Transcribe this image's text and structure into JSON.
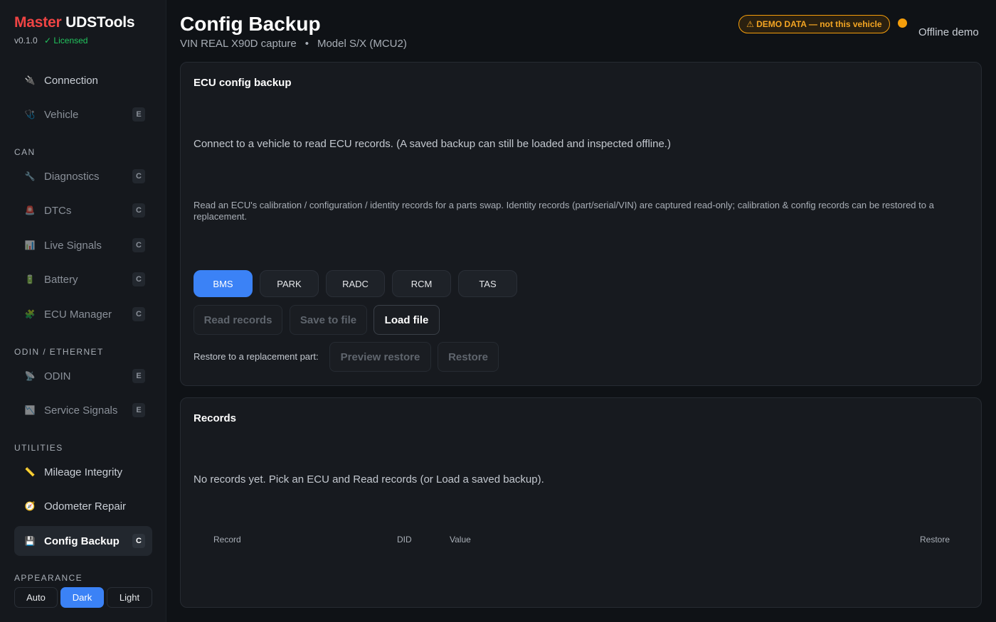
{
  "app": {
    "brand_red": "Master",
    "brand_white": "UDSTools",
    "version": "v0.1.0",
    "license": "✓ Licensed"
  },
  "sidebar": {
    "top_items": [
      {
        "label": "Connection",
        "icon": "plug-icon",
        "glyph": "🔌",
        "kbd": ""
      },
      {
        "label": "Vehicle",
        "icon": "stethoscope-icon",
        "glyph": "🩺",
        "kbd": "E"
      }
    ],
    "sections": {
      "can": "CAN",
      "odin": "ODIN / ETHERNET",
      "utilities": "UTILITIES",
      "appearance": "APPEARANCE"
    },
    "can_items": [
      {
        "label": "Diagnostics",
        "icon": "wrench-icon",
        "glyph": "🔧",
        "kbd": "C"
      },
      {
        "label": "DTCs",
        "icon": "alarm-icon",
        "glyph": "🚨",
        "kbd": "C"
      },
      {
        "label": "Live Signals",
        "icon": "chart-icon",
        "glyph": "📊",
        "kbd": "C"
      },
      {
        "label": "Battery",
        "icon": "battery-icon",
        "glyph": "🔋",
        "kbd": "C"
      },
      {
        "label": "ECU Manager",
        "icon": "puzzle-icon",
        "glyph": "🧩",
        "kbd": "C"
      }
    ],
    "odin_items": [
      {
        "label": "ODIN",
        "icon": "satellite-icon",
        "glyph": "📡",
        "kbd": "E"
      },
      {
        "label": "Service Signals",
        "icon": "chart-down-icon",
        "glyph": "📉",
        "kbd": "E"
      }
    ],
    "utility_items": [
      {
        "label": "Mileage Integrity",
        "icon": "ruler-icon",
        "glyph": "📏",
        "kbd": ""
      },
      {
        "label": "Odometer Repair",
        "icon": "gauge-icon",
        "glyph": "🧭",
        "kbd": ""
      },
      {
        "label": "Config Backup",
        "icon": "floppy-icon",
        "glyph": "💾",
        "kbd": "C"
      }
    ],
    "appearance": [
      "Auto",
      "Dark",
      "Light"
    ],
    "appearance_selected": "Dark"
  },
  "header": {
    "title": "Config Backup",
    "vin": "VIN REAL X90D capture",
    "sep": "•",
    "model": "Model S/X (MCU2)",
    "demo_badge": "⚠ DEMO DATA — not this vehicle",
    "status": "Offline demo",
    "status_color": "#f59e0b"
  },
  "backup": {
    "title": "ECU config backup",
    "connect_msg": "Connect to a vehicle to read ECU records. (A saved backup can still be loaded and inspected offline.)",
    "description": "Read an ECU's calibration / configuration / identity records for a parts swap. Identity records (part/serial/VIN) are captured read-only; calibration & config records can be restored to a replacement.",
    "ecus": [
      "BMS",
      "PARK",
      "RADC",
      "RCM",
      "TAS"
    ],
    "selected_ecu": "BMS",
    "read_btn": "Read records",
    "save_btn": "Save to file",
    "load_btn": "Load file",
    "restore_label": "Restore to a replacement part:",
    "preview_btn": "Preview restore",
    "restore_btn": "Restore"
  },
  "records": {
    "title": "Records",
    "empty_msg": "No records yet. Pick an ECU and Read records (or Load a saved backup).",
    "columns": [
      "Record",
      "DID",
      "Value",
      "Restore"
    ]
  },
  "colors": {
    "accent": "#3b82f6",
    "brand_red": "#ef4444",
    "licensed_green": "#22c55e",
    "warning": "#f59e0b"
  }
}
